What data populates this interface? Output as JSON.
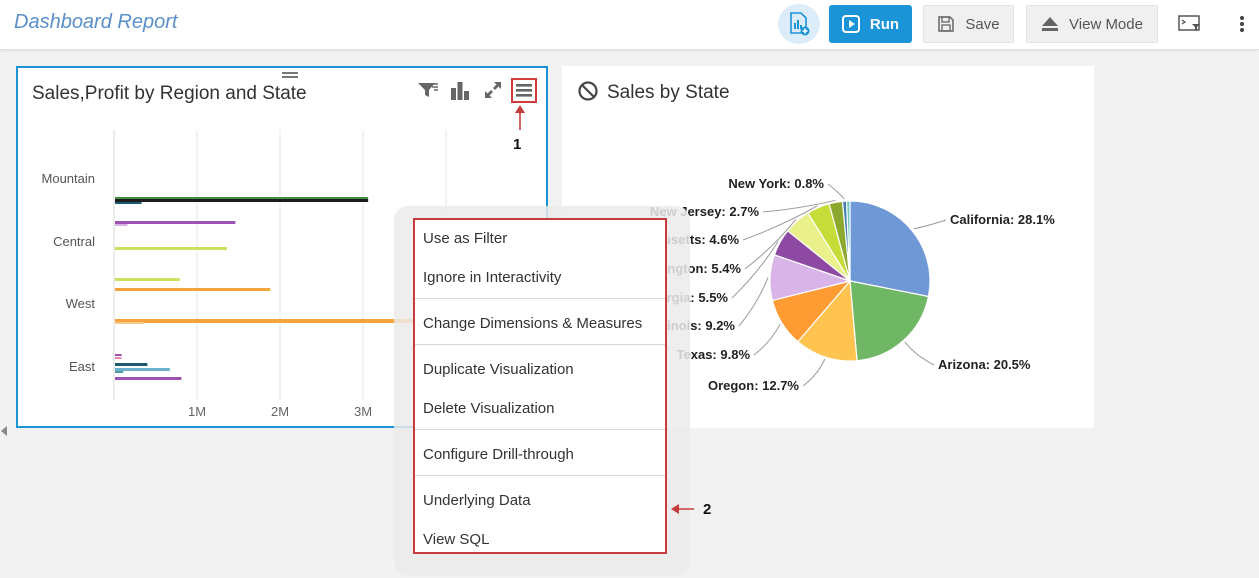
{
  "header": {
    "title": "Dashboard Report",
    "run_label": "Run",
    "save_label": "Save",
    "view_mode_label": "View Mode"
  },
  "colors": {
    "accent": "#1a94d6",
    "title_blue": "#5b8fc9",
    "highlight_red": "#c63c3c"
  },
  "left_panel": {
    "title": "Sales,Profit by Region and State",
    "icons": [
      "filter-icon",
      "bar-chart-icon",
      "expand-icon",
      "hamburger-menu-icon"
    ]
  },
  "right_panel": {
    "title": "Sales by State",
    "icons": [
      "ban-icon"
    ]
  },
  "callouts": {
    "one": "1",
    "two": "2"
  },
  "context_menu": {
    "items": [
      "Use as Filter",
      "Ignore in Interactivity",
      "Change Dimensions & Measures",
      "Duplicate Visualization",
      "Delete Visualization",
      "Configure Drill-through",
      "Underlying Data",
      "View SQL"
    ]
  },
  "chart_data": [
    {
      "type": "bar",
      "orientation": "horizontal",
      "categories": [
        "Mountain",
        "Central",
        "West",
        "East"
      ],
      "x_ticks": [
        "1M",
        "2M",
        "3M"
      ],
      "xlim": [
        0,
        4000000
      ],
      "grid": true,
      "bars": [
        {
          "category": "Mountain",
          "value": 3050000,
          "color": "#3f8f3f"
        },
        {
          "category": "Mountain",
          "value": 3050000,
          "color": "#1d1d1d"
        },
        {
          "category": "Mountain",
          "value": 320000,
          "color": "#1d5a6e"
        },
        {
          "category": "Central",
          "value": 1450000,
          "color": "#9b52b1"
        },
        {
          "category": "Central",
          "value": 150000,
          "color": "#d6b5e6"
        },
        {
          "category": "Central",
          "value": 1350000,
          "color": "#cfe060"
        },
        {
          "category": "West",
          "value": 780000,
          "color": "#cfe060"
        },
        {
          "category": "West",
          "value": 1870000,
          "color": "#f6a43c"
        },
        {
          "category": "West",
          "value": 3650000,
          "color": "#f6a43c"
        },
        {
          "category": "West",
          "value": 350000,
          "color": "#f7c98a"
        },
        {
          "category": "East",
          "value": 80000,
          "color": "#9b52b1"
        },
        {
          "category": "East",
          "value": 80000,
          "color": "#e58aaa"
        },
        {
          "category": "East",
          "value": 390000,
          "color": "#1d5a6e"
        },
        {
          "category": "East",
          "value": 660000,
          "color": "#6bb0cc"
        },
        {
          "category": "East",
          "value": 100000,
          "color": "#4f9c9c"
        },
        {
          "category": "East",
          "value": 800000,
          "color": "#9b52b1"
        }
      ]
    },
    {
      "type": "pie",
      "title": "Sales by State",
      "slices": [
        {
          "label": "California: 28.1%",
          "value": 28.1,
          "color": "#6f99d6"
        },
        {
          "label": "Arizona: 20.5%",
          "value": 20.5,
          "color": "#6fb764"
        },
        {
          "label": "Oregon: 12.7%",
          "value": 12.7,
          "color": "#ffc450"
        },
        {
          "label": "Texas: 9.8%",
          "value": 9.8,
          "color": "#ff9b33"
        },
        {
          "label": "Illinois: 9.2%",
          "value": 9.2,
          "color": "#d9b4e8"
        },
        {
          "label": "Georgia: 5.5%",
          "value": 5.5,
          "color": "#8e4aa3"
        },
        {
          "label": "Washington: 5.4%",
          "value": 5.4,
          "color": "#eaf08a"
        },
        {
          "label": "Massachusetts: 4.6%",
          "value": 4.6,
          "color": "#c6dc38"
        },
        {
          "label": "New Jersey: 2.7%",
          "value": 2.7,
          "color": "#8da82e"
        },
        {
          "label": "New York: 0.8%",
          "value": 0.8,
          "color": "#3f7fae"
        },
        {
          "label": "",
          "value": 0.7,
          "color": "#6fc6c0"
        }
      ]
    }
  ]
}
